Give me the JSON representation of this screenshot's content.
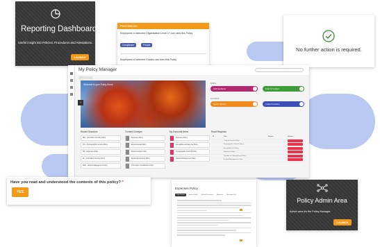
{
  "reporting": {
    "title": "Reporting Dashboard",
    "description": "Useful insight into Policies, Procedures and Attestations.",
    "button": "LAUNCH",
    "icon": "pie-chart-icon"
  },
  "permissions": {
    "header": "Permissions",
    "level_label": "Employees in selected Organisation Level 1+ can view this Policy",
    "level_chips": [
      "Compliance",
      "People"
    ],
    "grades_label": "Employees of selected Grades can view this Policy",
    "grade_chips": [
      "SLT",
      "Manager"
    ]
  },
  "no_action": {
    "message": "No further action is required.",
    "icon": "check-circle-icon"
  },
  "manager": {
    "title": "My Policy Manager",
    "subtitle": "Welcome to your Policy Home",
    "links_label": "LINKS",
    "actions_label": "ACTIONS",
    "pills": [
      {
        "label": "Staff Handbook",
        "color": "#b0286d"
      },
      {
        "label": "Code of Conduct",
        "color": "#3e9c3a"
      },
      {
        "label": "Recent Updates",
        "color": "#f08a1c"
      },
      {
        "label": "Create Procedure",
        "color": "#3a4fb8"
      }
    ],
    "sections": [
      "Recent Searches",
      "Content Changes",
      "My Favourite Items",
      "Read Requests"
    ],
    "recent": [
      "ISR - Information Security Policy",
      "ICA - Cryptographic Controls Policy",
      "HR - Expenses Policy",
      "ISI - Information Security Policy",
      "SAR - Incident Management Policy"
    ],
    "changes": [
      "Expenses Policy",
      "Environmental Policy",
      "Data Protection Policy",
      "Equal Opportunities Policy",
      "Information Classification Policy"
    ],
    "favourites": [
      "Expenses Policy",
      "Acceptable and Fair Use Policy",
      "Cryptographic Controls Policy",
      "Incident Management Policy"
    ],
    "table_headers": [
      "ID",
      "Title",
      "Expires",
      "Actions"
    ],
    "table_rows": [
      "Code of Practice Policy",
      "Cryptographic Controls Policy",
      "Acceptable Use Policy",
      "Expenses Policy",
      "Data Access Management Policy",
      "Incident Management Policy"
    ],
    "view_label": "View Item"
  },
  "question": {
    "text": "Have you read and understood the contents of this policy?",
    "required_mark": "*",
    "button": "YES"
  },
  "doc": {
    "title": "Expenses Policy",
    "tabs": [
      "Page Content",
      "Version History",
      "Related Documents",
      "Approvals",
      "Attestation Info"
    ]
  },
  "admin": {
    "title": "Policy Admin Area",
    "description": "Admin area for the Policy Manager.",
    "button": "LAUNCH",
    "icon": "network-nodes-icon"
  },
  "colors": {
    "blob": "#b9c9f2",
    "orange": "#f39a1a",
    "dark_card": "#3a3a3a"
  }
}
